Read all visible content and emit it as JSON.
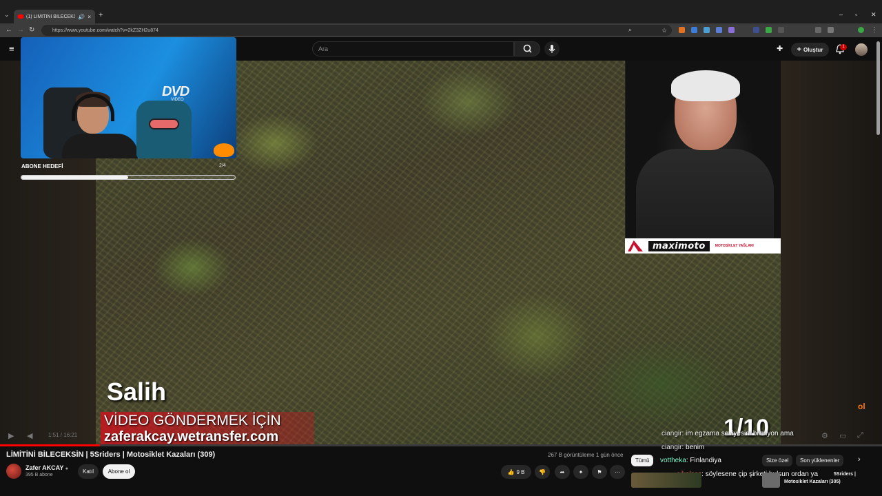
{
  "browser": {
    "tab_title": "(1) LİMİTİNİ BİLECEKSİN | 5S",
    "url": "https://www.youtube.com/watch?v=2kZ3ZH2u874"
  },
  "header": {
    "search_placeholder": "Ara",
    "create_label": "Oluştur",
    "notification_count": "1"
  },
  "stream_overlay": {
    "logo_text": "DVD",
    "logo_sub": "VIDEO",
    "goal_label": "ABONE HEDEFİ",
    "goal_count": "2/4",
    "goal_progress": 0.5
  },
  "video": {
    "caption_name": "Salih",
    "caption_line1": "VİDEO GÖNDERMEK İÇİN",
    "caption_line2": "zaferakcay.wetransfer.com",
    "counter": "1/10",
    "sponsor_logo": "maximoto",
    "sponsor_sub": "MOTOSİKLET YAĞLARI",
    "time": "1:51 / 16:21",
    "progress": 0.113,
    "corner_badge": "ol"
  },
  "chat": [
    {
      "user": "ciangir",
      "text": ": im egzama seviyesini bilmiyon ama"
    },
    {
      "user": "ciangir",
      "text": ": benim"
    },
    {
      "user": "vottheka",
      "text": ": Finlandiya"
    },
    {
      "user": "aikoless",
      "text": ": söylesene çip şirketi bulsun ordan ya"
    }
  ],
  "below": {
    "title": "LİMİTİNİ BİLECEKSİN | 5Sriders | Motosiklet Kazaları (309)",
    "channel_name": "Zafer AKCAY",
    "subscribers": "395 B abone",
    "join_label": "Katıl",
    "subscribe_label": "Abone ol",
    "views": "267 B görüntüleme  1 gün önce",
    "like_count": "9 B",
    "chips": [
      "Tümü",
      "Size özel",
      "Son yüklenenler"
    ],
    "reco_title": "Motosiklet Kazaları (305)",
    "reco_title_top": "5Sriders |"
  },
  "colors": {
    "accent": "#ff0000",
    "background": "#0f0f0f",
    "sponsor_red": "#c8102e"
  }
}
